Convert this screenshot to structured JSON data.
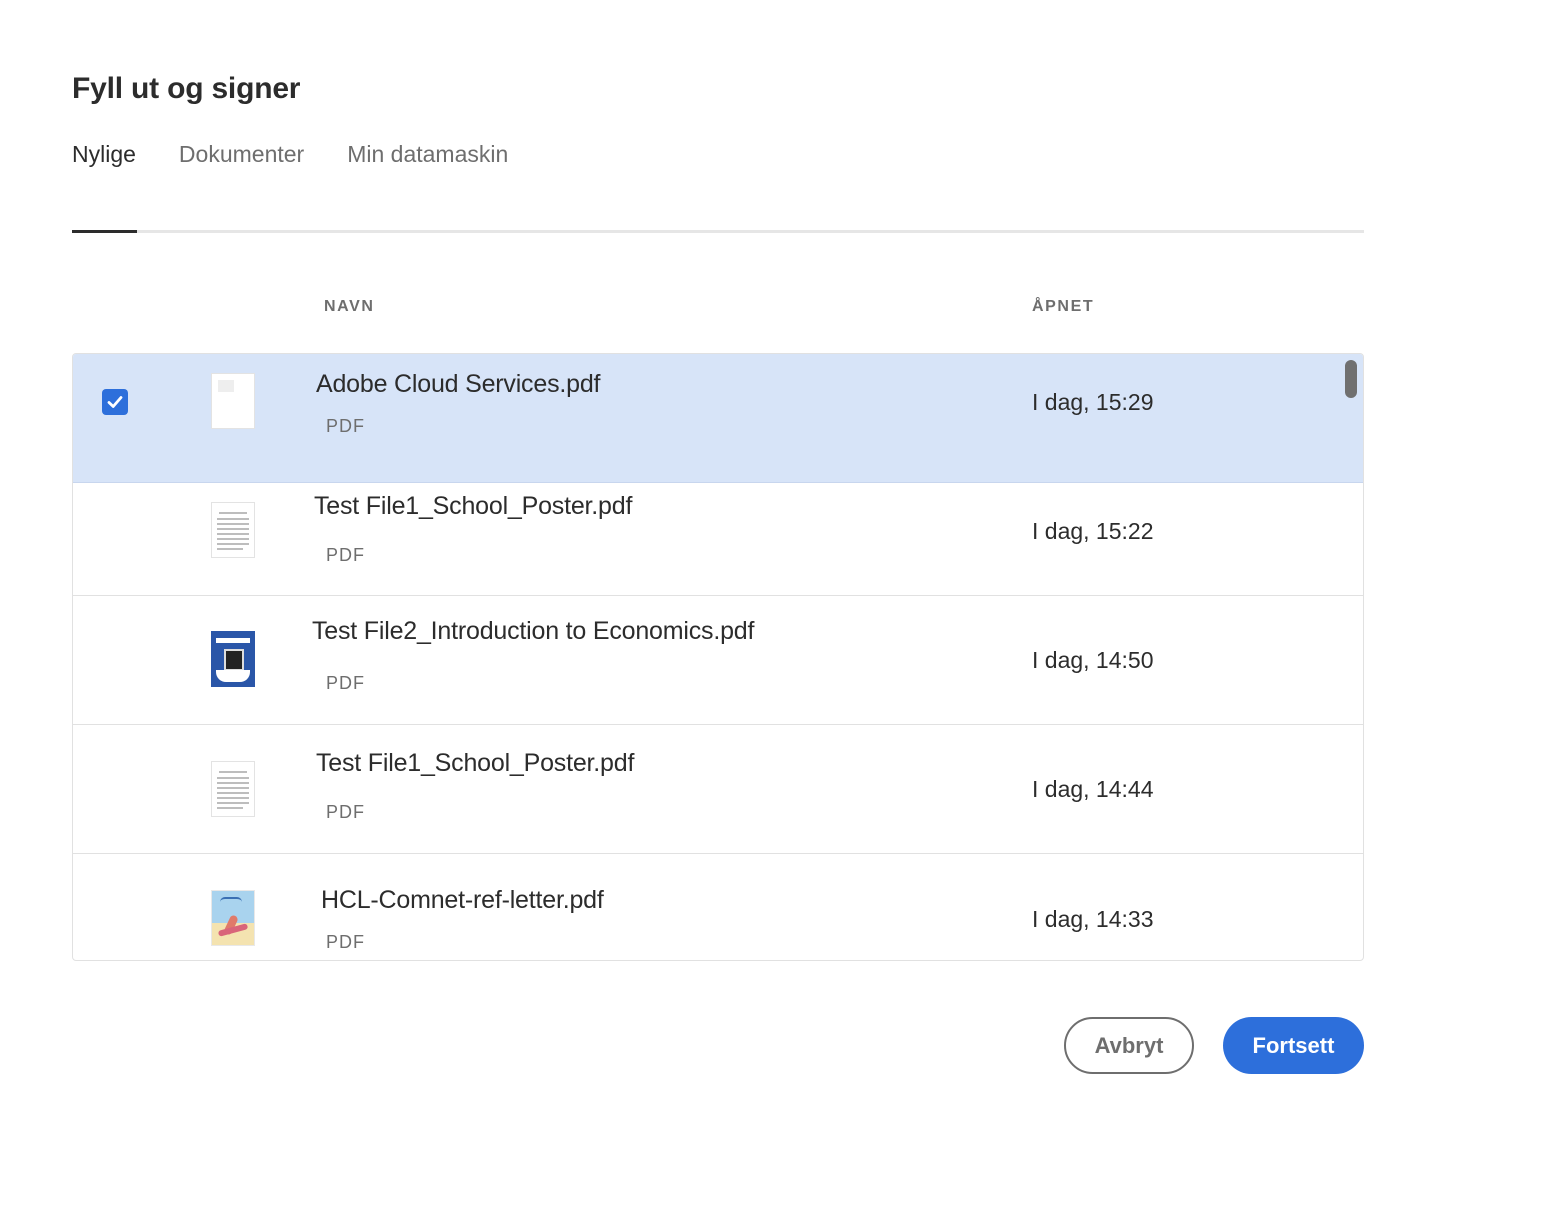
{
  "dialog": {
    "title": "Fyll ut og signer",
    "tabs": [
      {
        "label": "Nylige",
        "active": true
      },
      {
        "label": "Dokumenter",
        "active": false
      },
      {
        "label": "Min datamaskin",
        "active": false
      }
    ]
  },
  "table": {
    "columns": {
      "name": "NAVN",
      "opened": "ÅPNET"
    },
    "rows": [
      {
        "name": "Adobe Cloud Services.pdf",
        "type": "PDF",
        "opened": "I dag, 15:29",
        "selected": true,
        "thumbnail": "blank-page"
      },
      {
        "name": "Test File1_School_Poster.pdf",
        "type": "PDF",
        "opened": "I dag, 15:22",
        "selected": false,
        "thumbnail": "text-page"
      },
      {
        "name": "Test File2_Introduction to Economics.pdf",
        "type": "PDF",
        "opened": "I dag, 14:50",
        "selected": false,
        "thumbnail": "blue-cover"
      },
      {
        "name": "Test File1_School_Poster.pdf",
        "type": "PDF",
        "opened": "I dag, 14:44",
        "selected": false,
        "thumbnail": "text-page"
      },
      {
        "name": "HCL-Comnet-ref-letter.pdf",
        "type": "PDF",
        "opened": "I dag, 14:33",
        "selected": false,
        "thumbnail": "surf-illustration"
      }
    ]
  },
  "actions": {
    "cancel_label": "Avbryt",
    "continue_label": "Fortsett"
  },
  "colors": {
    "accent": "#2d6fdb",
    "selected_row": "#d7e4f8",
    "text": "#2c2c2c",
    "muted": "#6e6e6e"
  }
}
